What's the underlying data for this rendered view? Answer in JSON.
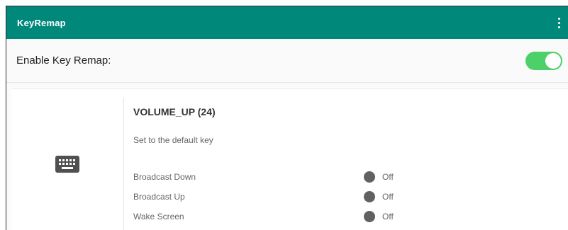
{
  "appbar": {
    "title": "KeyRemap",
    "menu_icon": "more-vert-icon"
  },
  "enable_row": {
    "label": "Enable Key Remap:",
    "toggle_on": true,
    "toggle_color": "#4cd06a"
  },
  "key_card": {
    "icon": "keyboard-icon",
    "key_name": "VOLUME_UP (24)",
    "subtitle": "Set to the default key",
    "options": [
      {
        "label": "Broadcast Down",
        "state": "Off"
      },
      {
        "label": "Broadcast Up",
        "state": "Off"
      },
      {
        "label": "Wake Screen",
        "state": "Off"
      }
    ]
  },
  "colors": {
    "appbar": "#00897b",
    "toggle": "#4cd06a"
  }
}
